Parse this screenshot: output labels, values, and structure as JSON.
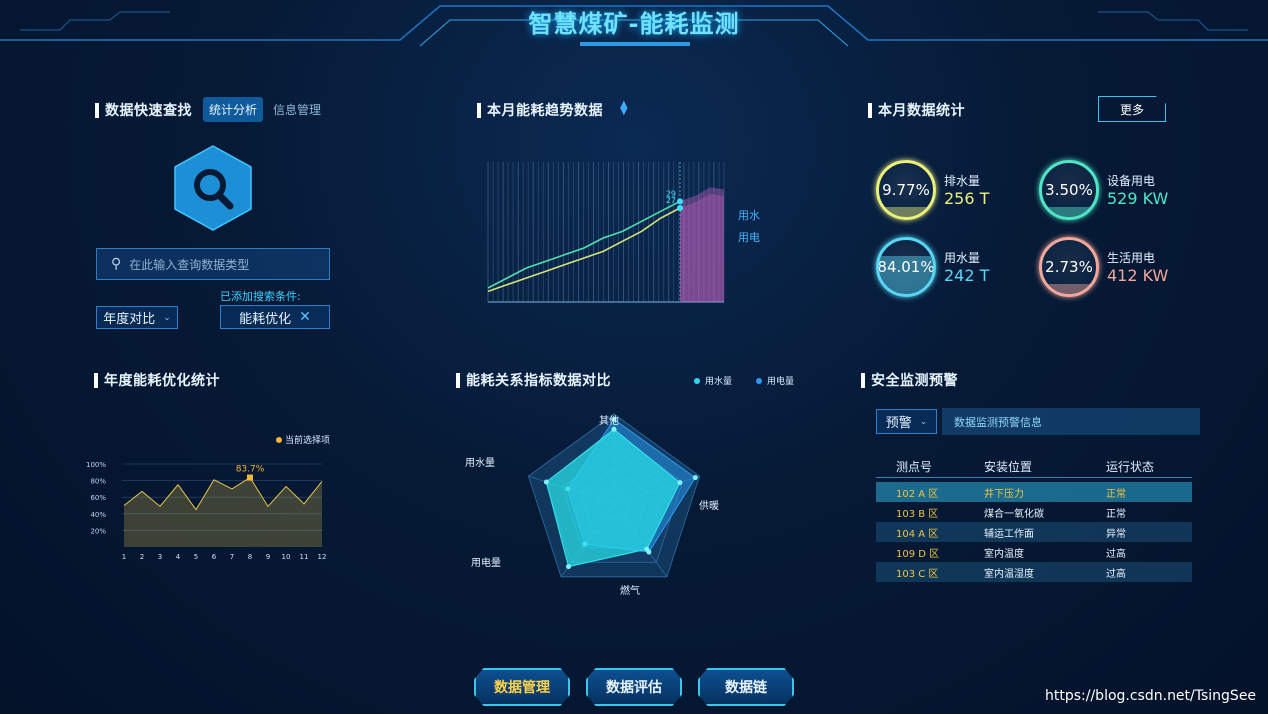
{
  "header": {
    "title": "智慧煤矿-能耗监测"
  },
  "search_panel": {
    "title": "数据快速查找",
    "tabs": [
      "统计分析",
      "信息管理"
    ],
    "active_tab": 0,
    "search_placeholder": "在此输入查询数据类型",
    "added_conditions_label": "已添加搜索条件:",
    "select_value": "年度对比",
    "condition_tag": "能耗优化"
  },
  "trend_panel": {
    "title": "本月能耗趋势数据",
    "series": [
      {
        "name": "用水",
        "end_value_label": "29",
        "color": "#e06bd2"
      },
      {
        "name": "用电",
        "end_value_label": "27",
        "color": "#e09bd0"
      }
    ]
  },
  "stats_panel": {
    "title": "本月数据统计",
    "more_button": "更多",
    "items": [
      {
        "percent": "9.77%",
        "percent_value": 9.77,
        "label": "排水量",
        "value": "256 T",
        "color": "#eaf07a"
      },
      {
        "percent": "3.50%",
        "percent_value": 3.5,
        "label": "设备用电",
        "value": "529 KW",
        "color": "#4fe6c6"
      },
      {
        "percent": "84.01%",
        "percent_value": 84.01,
        "label": "用水量",
        "value": "242 T",
        "color": "#58d6f4"
      },
      {
        "percent": "2.73%",
        "percent_value": 2.73,
        "label": "生活用电",
        "value": "412 KW",
        "color": "#f2a79a"
      }
    ]
  },
  "yearly_panel": {
    "title": "年度能耗优化统计",
    "legend": "当前选择项",
    "highlight_label": "83.7%",
    "colors": {
      "line": "#e8c44a",
      "highlight": "#f1b735"
    }
  },
  "relation_panel": {
    "title": "能耗关系指标数据对比",
    "legend": [
      "用水量",
      "用电量"
    ],
    "radar_labels": [
      "其他",
      "供暖",
      "燃气",
      "用电量",
      "用水量"
    ]
  },
  "safety_panel": {
    "title": "安全监测预警",
    "select_value": "预警",
    "info_text": "数据监测预警信息",
    "headers": [
      "测点号",
      "安装位置",
      "运行状态"
    ],
    "rows": [
      {
        "id": "102 A 区",
        "location": "井下压力",
        "status": "正常"
      },
      {
        "id": "103 B 区",
        "location": "煤合一氧化碳",
        "status": "正常"
      },
      {
        "id": "104 A 区",
        "location": "辅运工作面",
        "status": "异常"
      },
      {
        "id": "109 D 区",
        "location": "室内温度",
        "status": "过高"
      },
      {
        "id": "103 C 区",
        "location": "室内温湿度",
        "status": "过高"
      }
    ]
  },
  "footer": {
    "buttons": [
      "数据管理",
      "数据评估",
      "数据链"
    ]
  },
  "watermark": "https://blog.csdn.net/TsingSee",
  "chart_data": [
    {
      "type": "line",
      "title": "年度能耗优化统计",
      "x": [
        1,
        2,
        3,
        4,
        5,
        6,
        7,
        8,
        9,
        10,
        11,
        12
      ],
      "values": [
        50,
        67,
        49,
        75,
        45,
        81,
        70,
        83.7,
        49,
        73,
        52,
        79
      ],
      "ylim": [
        0,
        100
      ],
      "y_ticks": [
        "20%",
        "40%",
        "60%",
        "80%",
        "100%"
      ],
      "highlight_index": 7,
      "legend": "当前选择项"
    },
    {
      "type": "line",
      "title": "本月能耗趋势数据",
      "series": [
        {
          "name": "用水",
          "values": [
            3,
            6,
            9,
            11,
            13,
            15,
            18,
            20,
            23,
            26,
            29
          ]
        },
        {
          "name": "用电",
          "values": [
            2,
            4,
            6,
            8,
            10,
            12,
            14,
            17,
            20,
            24,
            27
          ]
        }
      ]
    },
    {
      "type": "radar",
      "title": "能耗关系指标数据对比",
      "axes": [
        "其他",
        "供暖",
        "燃气",
        "用电量",
        "用水量"
      ],
      "series": [
        {
          "name": "用水量",
          "values": [
            0.83,
            0.77,
            0.62,
            0.86,
            0.79
          ]
        },
        {
          "name": "用电量",
          "values": [
            0.94,
            0.95,
            0.66,
            0.55,
            0.54
          ]
        }
      ]
    }
  ]
}
